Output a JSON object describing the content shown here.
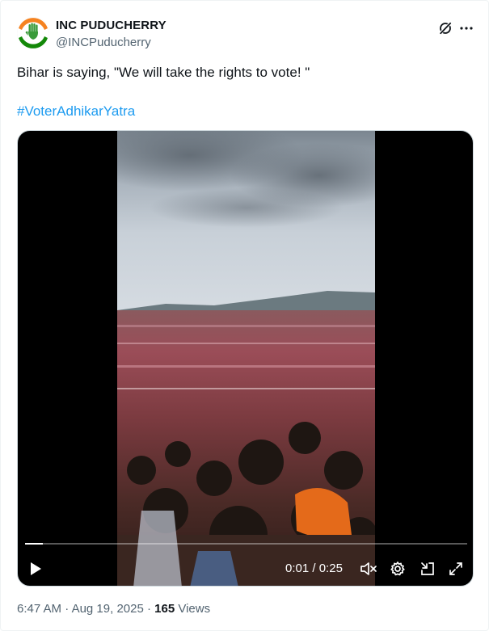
{
  "author": {
    "name": "INC PUDUCHERRY",
    "handle": "@INCPuducherry"
  },
  "tweet": {
    "text": "Bihar is saying, \"We will take the rights to vote! \"",
    "hashtag": "#VoterAdhikarYatra"
  },
  "video": {
    "current_time": "0:01",
    "separator": " / ",
    "duration": "0:25",
    "progress": 0.04
  },
  "meta": {
    "time": "6:47 AM",
    "dot1": " · ",
    "date": "Aug 19, 2025",
    "dot2": " · ",
    "views_count": "165",
    "views_label": " Views"
  },
  "icons": {
    "grok": "grok-icon",
    "more": "more-dots-icon",
    "play": "play-icon",
    "mute": "mute-icon",
    "settings": "gear-icon",
    "minimize": "minimize-icon",
    "fullscreen": "fullscreen-icon"
  },
  "colors": {
    "accent": "#1d9bf0",
    "logo_saffron": "#f58220",
    "logo_green": "#138808"
  }
}
